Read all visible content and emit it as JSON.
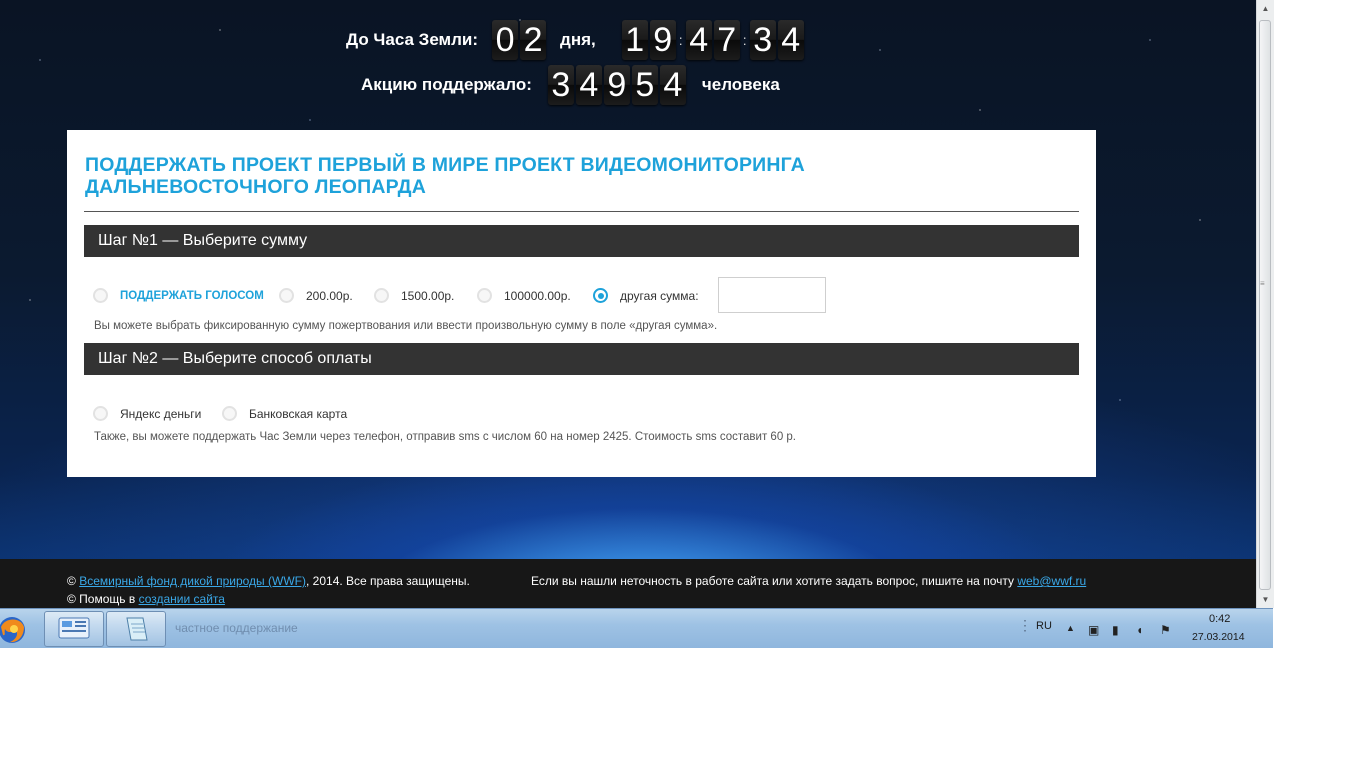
{
  "countdown": {
    "label": "До Часа Земли:",
    "days": [
      "0",
      "2"
    ],
    "days_label": "дня,",
    "hours": [
      "1",
      "9"
    ],
    "minutes": [
      "4",
      "7"
    ],
    "seconds": [
      "3",
      "4"
    ],
    "separator": ":"
  },
  "supporters": {
    "label": "Акцию поддержало:",
    "digits": [
      "3",
      "4",
      "9",
      "5",
      "4"
    ],
    "suffix": "человека"
  },
  "panel": {
    "title_line1": "ПОДДЕРЖАТЬ ПРОЕКТ ПЕРВЫЙ В МИРЕ ПРОЕКТ ВИДЕОМОНИТОРИНГА",
    "title_line2": "ДАЛЬНЕВОСТОЧНОГО ЛЕОПАРДА",
    "step1": {
      "title": "Шаг №1 — Выберите сумму",
      "options": [
        {
          "label": "ПОДДЕРЖАТЬ ГОЛОСОМ",
          "selected": false
        },
        {
          "label": "200.00р.",
          "selected": false
        },
        {
          "label": "1500.00р.",
          "selected": false
        },
        {
          "label": "100000.00р.",
          "selected": false
        },
        {
          "label": "другая сумма:",
          "selected": true
        }
      ],
      "custom_amount_value": "",
      "note": "Вы можете выбрать фиксированную сумму пожертвования или ввести произвольную сумму в поле «другая сумма»."
    },
    "step2": {
      "title": "Шаг №2 — Выберите способ оплаты",
      "options": [
        {
          "label": "Яндекс деньги",
          "selected": false
        },
        {
          "label": "Банковская карта",
          "selected": false
        }
      ],
      "note": "Также, вы можете поддержать Час Земли через телефон, отправив sms с числом 60 на номер 2425. Стоимость sms составит 60 р."
    },
    "accent_color": "#1ea2da"
  },
  "footer": {
    "copyright_symbol": "©",
    "org_link": "Всемирный фонд дикой природы (WWF)",
    "copyright_rest": ", 2014. Все права защищены.",
    "help_prefix": "© Помощь в",
    "help_link": "создании сайта",
    "contact_text": "Если вы нашли неточность в работе сайта или хотите задать вопрос, пишите на почту",
    "contact_email": "web@wwf.ru"
  },
  "taskbar": {
    "ghost_text": "частное поддержание",
    "language": "RU",
    "time": "0:42",
    "date": "27.03.2014"
  }
}
